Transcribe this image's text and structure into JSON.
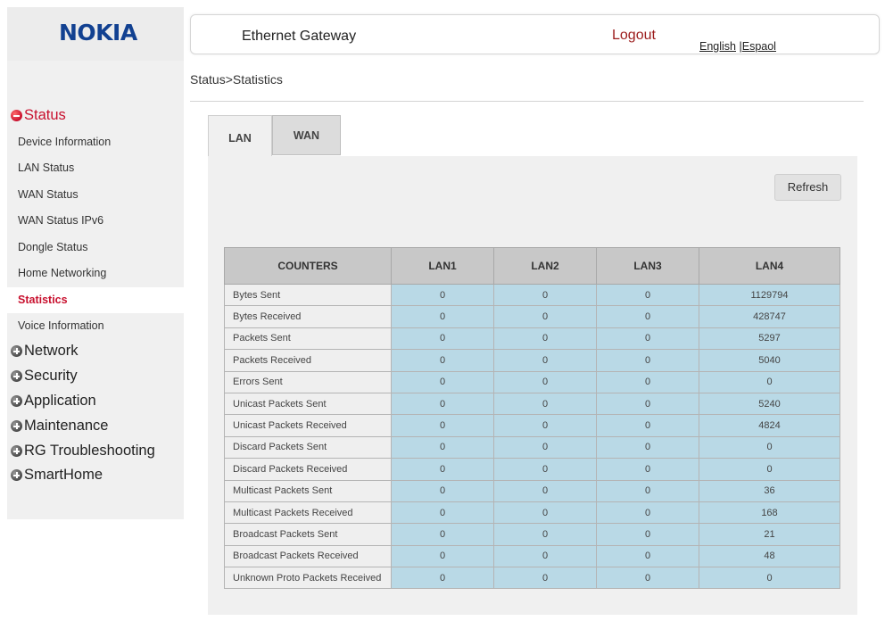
{
  "brand": {
    "logo_text": "NOKIA"
  },
  "header": {
    "title": "Ethernet Gateway",
    "logout": "Logout",
    "lang_english": "English",
    "lang_sep": " |",
    "lang_espanol": "Espaol"
  },
  "breadcrumb": "Status>Statistics",
  "sidebar": {
    "status_group": "Status",
    "items": [
      "Device Information",
      "LAN Status",
      "WAN Status",
      "WAN Status IPv6",
      "Dongle Status",
      "Home Networking",
      "Statistics",
      "Voice Information"
    ],
    "active_item": "Statistics",
    "groups": [
      "Network",
      "Security",
      "Application",
      "Maintenance",
      "RG Troubleshooting",
      "SmartHome"
    ]
  },
  "tabs": {
    "lan": "LAN",
    "wan": "WAN",
    "active": "LAN"
  },
  "refresh_label": "Refresh",
  "table": {
    "headers": [
      "COUNTERS",
      "LAN1",
      "LAN2",
      "LAN3",
      "LAN4"
    ],
    "rows": [
      [
        "Bytes Sent",
        "0",
        "0",
        "0",
        "1129794"
      ],
      [
        "Bytes Received",
        "0",
        "0",
        "0",
        "428747"
      ],
      [
        "Packets Sent",
        "0",
        "0",
        "0",
        "5297"
      ],
      [
        "Packets Received",
        "0",
        "0",
        "0",
        "5040"
      ],
      [
        "Errors Sent",
        "0",
        "0",
        "0",
        "0"
      ],
      [
        "Unicast Packets Sent",
        "0",
        "0",
        "0",
        "5240"
      ],
      [
        "Unicast Packets Received",
        "0",
        "0",
        "0",
        "4824"
      ],
      [
        "Discard Packets Sent",
        "0",
        "0",
        "0",
        "0"
      ],
      [
        "Discard Packets Received",
        "0",
        "0",
        "0",
        "0"
      ],
      [
        "Multicast Packets Sent",
        "0",
        "0",
        "0",
        "36"
      ],
      [
        "Multicast Packets Received",
        "0",
        "0",
        "0",
        "168"
      ],
      [
        "Broadcast Packets Sent",
        "0",
        "0",
        "0",
        "21"
      ],
      [
        "Broadcast Packets Received",
        "0",
        "0",
        "0",
        "48"
      ],
      [
        "Unknown Proto Packets Received",
        "0",
        "0",
        "0",
        "0"
      ]
    ]
  },
  "colors": {
    "brand_blue": "#124191",
    "status_red": "#c8102e",
    "cell_blue": "#b9d9e6"
  }
}
